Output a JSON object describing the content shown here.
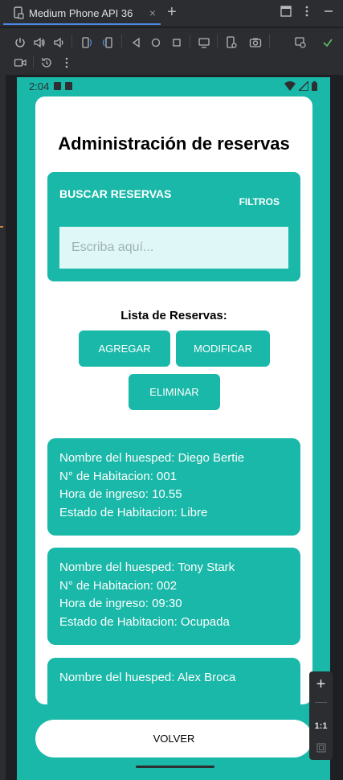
{
  "ide": {
    "tab_title": "Medium Phone API 36",
    "tab_close": "×",
    "tab_add": "+"
  },
  "device": {
    "time": "2:04"
  },
  "app": {
    "title": "Administración de reservas",
    "search": {
      "title": "BUSCAR RESERVAS",
      "filters_label": "FILTROS",
      "placeholder": "Escriba aquí..."
    },
    "list_title": "Lista de Reservas:",
    "buttons": {
      "add": "AGREGAR",
      "modify": "MODIFICAR",
      "delete": "ELIMINAR"
    },
    "reservations": [
      {
        "guest": "Nombre del huesped: Diego Bertie",
        "room": "N° de Habitacion: 001",
        "time": "Hora de ingreso: 10.55",
        "status": "Estado de Habitacion: Libre"
      },
      {
        "guest": "Nombre del huesped: Tony Stark",
        "room": "N° de Habitacion: 002",
        "time": "Hora de ingreso: 09:30",
        "status": "Estado de Habitacion: Ocupada"
      },
      {
        "guest": "Nombre del huesped: Alex Broca",
        "room": "",
        "time": "",
        "status": ""
      }
    ],
    "back_label": "VOLVER"
  },
  "zoom_panel": {
    "zoom_in": "+",
    "one_to_one": "1:1"
  },
  "colors": {
    "accent": "#19b8a8",
    "input_bg": "#e0f7f7",
    "ide_bg": "#2b2d30",
    "tab_underline": "#4a88e6",
    "run_check": "#5fb865"
  }
}
